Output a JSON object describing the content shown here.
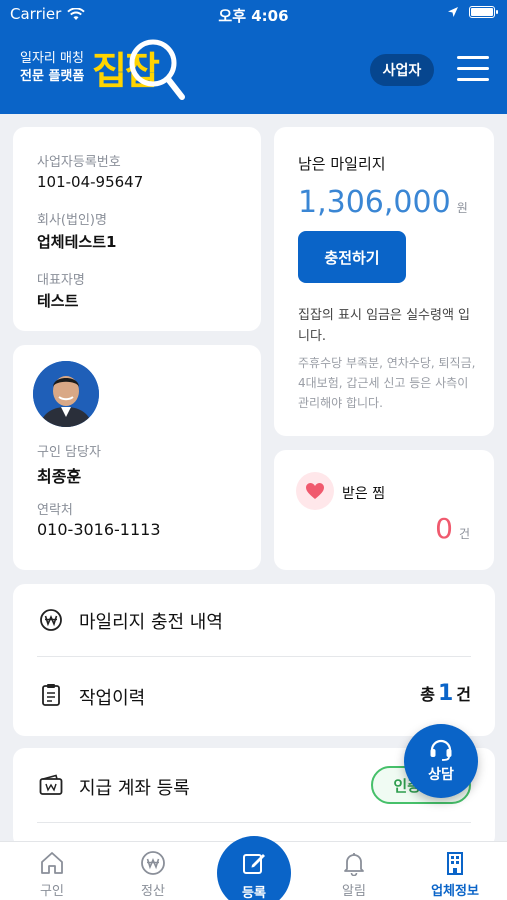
{
  "status": {
    "carrier": "Carrier",
    "time": "오후 4:06"
  },
  "header": {
    "logo_line1": "일자리 매칭",
    "logo_line2": "전문 플랫폼",
    "logo_main": "집잡",
    "biz_label": "사업자"
  },
  "company": {
    "reg_no_label": "사업자등록번호",
    "reg_no": "101-04-95647",
    "name_label": "회사(법인)명",
    "name": "업체테스트1",
    "ceo_label": "대표자명",
    "ceo": "테스트"
  },
  "manager": {
    "role_label": "구인 담당자",
    "name": "최종훈",
    "contact_label": "연락처",
    "phone": "010-3016-1113"
  },
  "mileage": {
    "title": "남은 마일리지",
    "amount": "1,306,000",
    "unit": "원",
    "charge_label": "충전하기",
    "note_main": "집잡의 표시 임금은 실수령액 입니다.",
    "note_sub": "주휴수당 부족분, 연차수당, 퇴직금, 4대보험, 갑근세 신고 등은 사측이 관리해야 합니다."
  },
  "likes": {
    "title": "받은 찜",
    "count": "0",
    "unit": "건"
  },
  "menu": {
    "mileage_history": "마일리지 충전 내역",
    "work_history": "작업이력",
    "work_count_prefix": "총",
    "work_count": "1",
    "work_count_unit": "건",
    "account_register": "지급 계좌 등록",
    "verified_label": "인증완료"
  },
  "consult_label": "상담",
  "tabs": [
    {
      "label": "구인"
    },
    {
      "label": "정산"
    },
    {
      "label": "등록"
    },
    {
      "label": "알림"
    },
    {
      "label": "업체정보"
    }
  ],
  "colors": {
    "primary": "#0a64c8",
    "accent_yellow": "#ffd400",
    "like_red": "#f05a6e",
    "verified_green": "#46c06a"
  }
}
